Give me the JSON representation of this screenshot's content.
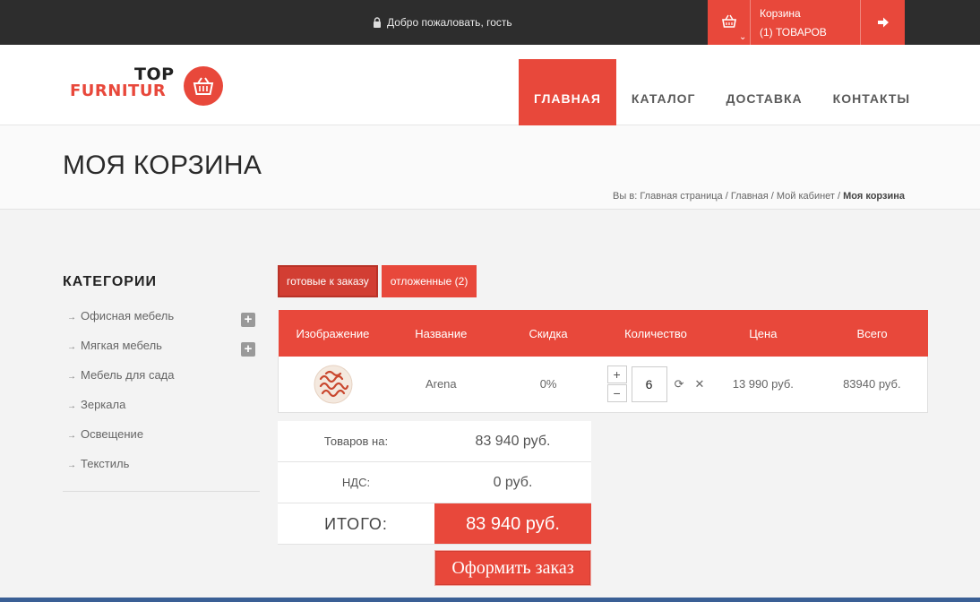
{
  "topbar": {
    "welcome": "Добро пожаловать, гость",
    "cart_title": "Корзина",
    "cart_count": "(1) ТОВАРОВ"
  },
  "logo": {
    "line1": "TOP",
    "line2": "FURNITUR"
  },
  "nav": [
    {
      "label": "ГЛАВНАЯ",
      "active": true
    },
    {
      "label": "КАТАЛОГ"
    },
    {
      "label": "ДОСТАВКА"
    },
    {
      "label": "КОНТАКТЫ"
    }
  ],
  "page": {
    "title": "МОЯ КОРЗИНА",
    "breadcrumb_prefix": "Вы в:",
    "breadcrumb": [
      "Главная страница",
      "Главная",
      "Мой кабинет"
    ],
    "breadcrumb_current": "Моя корзина"
  },
  "sidebar": {
    "heading": "КАТЕГОРИИ",
    "items": [
      {
        "label": "Офисная мебель",
        "expandable": true
      },
      {
        "label": "Мягкая мебель",
        "expandable": true
      },
      {
        "label": "Мебель для сада"
      },
      {
        "label": "Зеркала"
      },
      {
        "label": "Освещение"
      },
      {
        "label": "Текстиль"
      }
    ]
  },
  "tabs": [
    {
      "label": "готовые к заказу",
      "active": true
    },
    {
      "label": "отложенные (2)"
    }
  ],
  "cart": {
    "headers": [
      "Изображение",
      "Название",
      "Скидка",
      "Количество",
      "Цена",
      "Всего"
    ],
    "rows": [
      {
        "name": "Arena",
        "discount": "0%",
        "quantity": "6",
        "price": "13 990 руб.",
        "total": "83940 руб."
      }
    ]
  },
  "totals": {
    "subtotal_label": "Товаров на:",
    "subtotal_value": "83 940 руб.",
    "vat_label": "НДС:",
    "vat_value": "0 руб.",
    "grand_label": "ИТОГО:",
    "grand_value": "83 940 руб.",
    "order_button": "Оформить заказ"
  },
  "colors": {
    "accent": "#e8483b",
    "topbar": "#2d2d2d"
  }
}
